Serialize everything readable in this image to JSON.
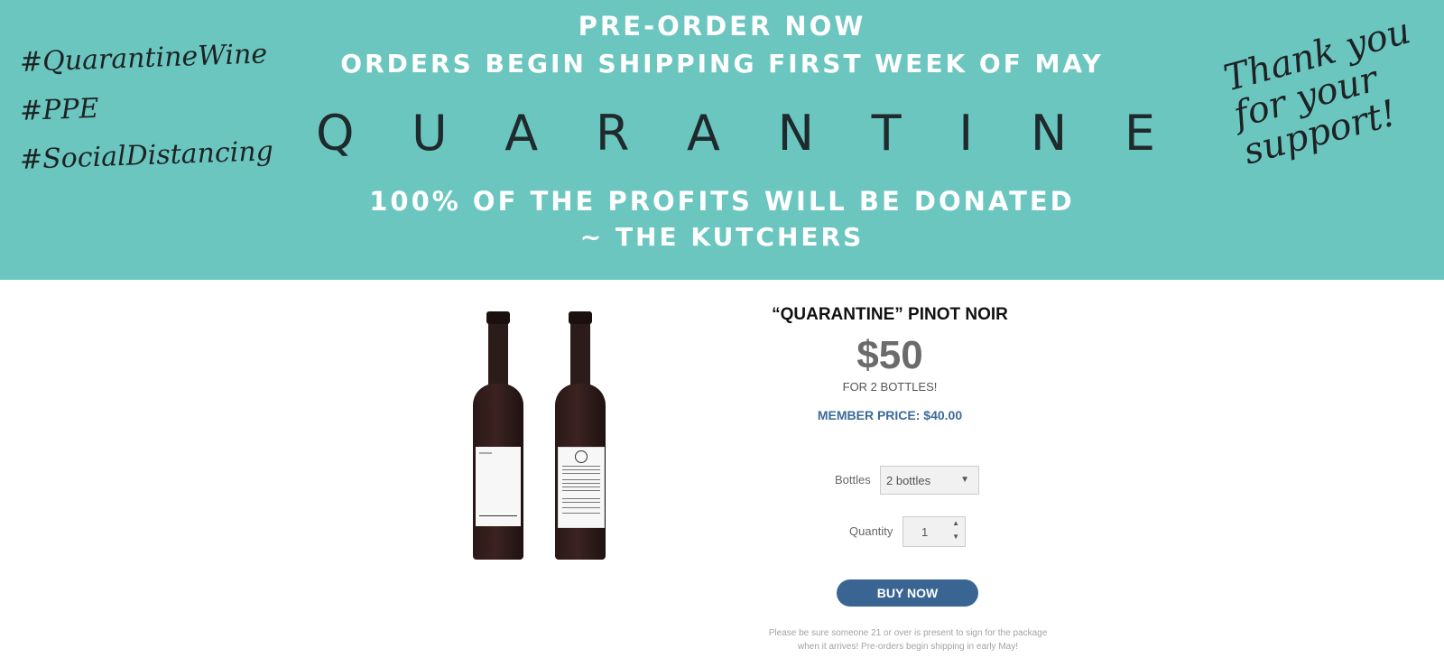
{
  "banner": {
    "line1": "PRE-ORDER NOW",
    "line2": "ORDERS BEGIN SHIPPING FIRST WEEK OF MAY",
    "brand_letters": [
      "Q",
      "U",
      "A",
      "R",
      "A",
      "N",
      "T",
      "I",
      "N",
      "E"
    ],
    "line3": "100% OF THE PROFITS WILL BE DONATED",
    "line4": "~ THE KUTCHERS",
    "hashtags": [
      "#QuarantineWine",
      "#PPE",
      "#SocialDistancing"
    ],
    "thanks_lines": [
      "Thank you",
      "for your",
      "support!"
    ],
    "background_color": "#6cc6c0"
  },
  "product": {
    "title": "“QUARANTINE” PINOT NOIR",
    "price": "$50",
    "subtext": "FOR 2 BOTTLES!",
    "member_price": "MEMBER PRICE: $40.00",
    "bottles_label": "Bottles",
    "bottles_value": "2 bottles",
    "quantity_label": "Quantity",
    "quantity_value": "1",
    "buy_label": "BUY NOW",
    "note_line1": "Please be sure someone 21 or over is present to sign for the package",
    "note_line2": "when it arrives! Pre-orders begin shipping in early May!",
    "accent_color": "#3a6593"
  }
}
